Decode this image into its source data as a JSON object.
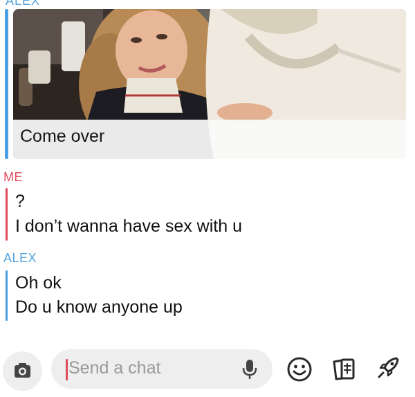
{
  "conversation": {
    "top_sender_cut": "ALEX",
    "media_message": {
      "caption": "Come over"
    },
    "groups": [
      {
        "sender": "ME",
        "lines": [
          "?",
          "I don’t wanna have sex with u"
        ]
      },
      {
        "sender": "ALEX",
        "lines": [
          "Oh ok",
          "Do u know anyone up"
        ]
      }
    ]
  },
  "composer": {
    "placeholder": "Send a chat",
    "icons": [
      "camera-icon",
      "microphone-icon",
      "emoji-icon",
      "stickers-icon",
      "rocket-icon"
    ]
  },
  "colors": {
    "me_accent": "#e04a5a",
    "friend_accent": "#56a3dc",
    "input_background": "#eeeeee",
    "placeholder_text": "#9a9a9a"
  }
}
